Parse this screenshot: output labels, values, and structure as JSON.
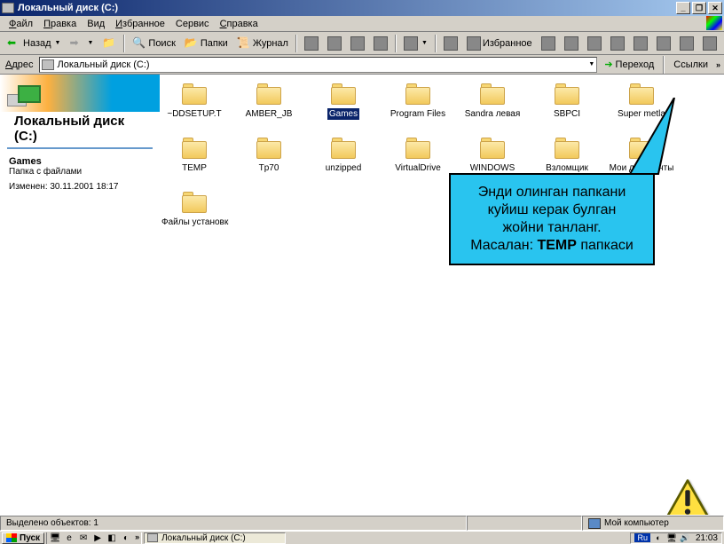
{
  "window": {
    "title": "Локальный диск (C:)"
  },
  "winbuttons": {
    "min": "_",
    "max": "❐",
    "close": "✕"
  },
  "menu": {
    "file": "Файл",
    "edit": "Правка",
    "view": "Вид",
    "favorites": "Избранное",
    "tools": "Сервис",
    "help": "Справка"
  },
  "toolbar": {
    "back": "Назад",
    "search": "Поиск",
    "folders": "Папки",
    "history": "Журнал",
    "favorites": "Избранное"
  },
  "addr": {
    "label": "Адрес",
    "value": "Локальный диск (C:)",
    "go": "Переход",
    "links": "Ссылки"
  },
  "sidebar": {
    "title": "Локальный диск (C:)",
    "sel_name": "Games",
    "sel_type": "Папка с файлами",
    "sel_modified": "Изменен: 30.11.2001 18:17"
  },
  "folders": [
    {
      "label": "~DDSETUP.T",
      "selected": false
    },
    {
      "label": "AMBER_JB",
      "selected": false
    },
    {
      "label": "Games",
      "selected": true
    },
    {
      "label": "Program Files",
      "selected": false
    },
    {
      "label": "Sandra левая",
      "selected": false
    },
    {
      "label": "SBPCI",
      "selected": false
    },
    {
      "label": "Super metla",
      "selected": false
    },
    {
      "label": "TEMP",
      "selected": false
    },
    {
      "label": "Tp70",
      "selected": false
    },
    {
      "label": "unzipped",
      "selected": false
    },
    {
      "label": "VirtualDrive",
      "selected": false
    },
    {
      "label": "WINDOWS",
      "selected": false
    },
    {
      "label": "Взломщик",
      "selected": false
    },
    {
      "label": "Мои документы",
      "selected": false
    },
    {
      "label": "Файлы установки Update",
      "selected": false
    }
  ],
  "callout": {
    "line1": "Энди олинган папкани",
    "line2": "куйиш керак булган",
    "line3": "жойни танланг.",
    "line4a": "Масалан: ",
    "line4b": "TEMP",
    "line4c": " папкаси"
  },
  "status": {
    "selected": "Выделено объектов: 1",
    "location": "Мой компьютер"
  },
  "taskbar": {
    "start": "Пуск",
    "task": "Локальный диск (C:)",
    "lang": "Ru",
    "clock": "21:03"
  }
}
